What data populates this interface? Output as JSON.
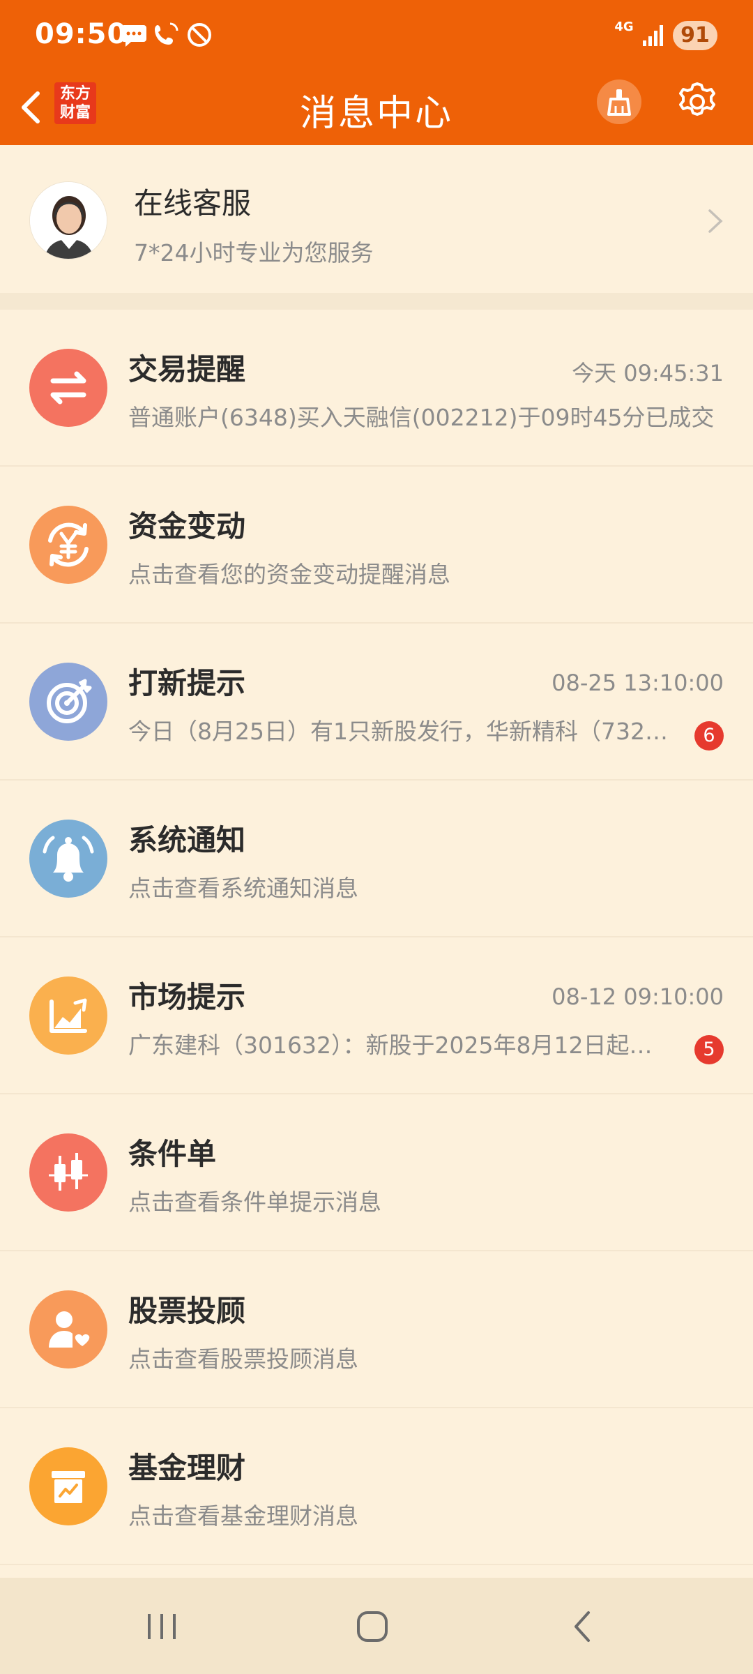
{
  "status_bar": {
    "time": "09:50",
    "network": "4G",
    "battery": "91"
  },
  "header": {
    "logo_line1": "东方",
    "logo_line2": "财富",
    "title": "消息中心"
  },
  "customer_service": {
    "title": "在线客服",
    "subtitle": "7*24小时专业为您服务"
  },
  "items": [
    {
      "title": "交易提醒",
      "time": "今天 09:45:31",
      "desc": "普通账户(6348)买入天融信(002212)于09时45分已成交",
      "icon": "swap-icon",
      "color": "#f47360"
    },
    {
      "title": "资金变动",
      "time": "",
      "desc": "点击查看您的资金变动提醒消息",
      "icon": "yuan-cycle-icon",
      "color": "#f89a5a"
    },
    {
      "title": "打新提示",
      "time": "08-25 13:10:00",
      "desc": "今日（8月25日）有1只新股发行，华新精科（732…",
      "badge": "6",
      "icon": "target-icon",
      "color": "#8ea6d8"
    },
    {
      "title": "系统通知",
      "time": "",
      "desc": "点击查看系统通知消息",
      "icon": "bell-icon",
      "color": "#7aaed6"
    },
    {
      "title": "市场提示",
      "time": "08-12 09:10:00",
      "desc": "广东建科（301632）：新股于2025年8月12日起…",
      "badge": "5",
      "icon": "trend-chart-icon",
      "color": "#fab04e"
    },
    {
      "title": "条件单",
      "time": "",
      "desc": "点击查看条件单提示消息",
      "icon": "candlestick-icon",
      "color": "#f47360"
    },
    {
      "title": "股票投顾",
      "time": "",
      "desc": "点击查看股票投顾消息",
      "icon": "advisor-icon",
      "color": "#f89a5a"
    },
    {
      "title": "基金理财",
      "time": "",
      "desc": "点击查看基金理财消息",
      "icon": "fund-box-icon",
      "color": "#fba532"
    }
  ],
  "colors": {
    "brand": "#ee6107",
    "background": "#fdf1dc",
    "badge": "#e63a2e"
  }
}
